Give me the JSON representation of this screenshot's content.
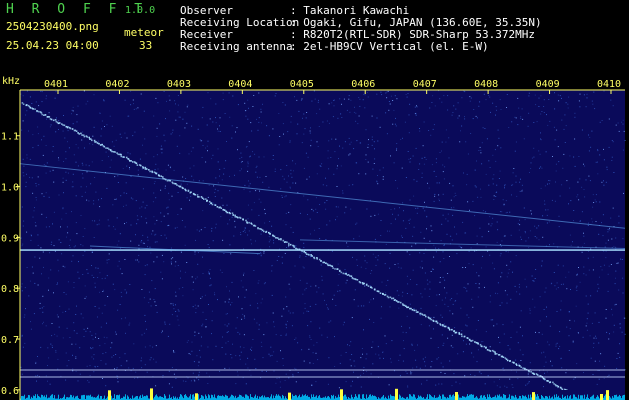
{
  "header": {
    "brand": "H R O F F T",
    "version": "1.0.0",
    "filename": "2504230400.png",
    "mode": "meteor",
    "datetime": "25.04.23 04:00",
    "count": "33",
    "info": [
      {
        "label": "Observer",
        "value": ": Takanori Kawachi"
      },
      {
        "label": "Receiving Location",
        "value": ": Ogaki, Gifu, JAPAN (136.60E, 35.35N)"
      },
      {
        "label": "Receiver",
        "value": ": R820T2(RTL-SDR) SDR-Sharp 53.372MHz"
      },
      {
        "label": "Receiving antenna",
        "value": ": 2el-HB9CV Vertical (el. E-W)"
      }
    ]
  },
  "chart_data": {
    "type": "heatmap",
    "ylabel": "kHz",
    "x_ticks": [
      "0401",
      "0402",
      "0403",
      "0404",
      "0405",
      "0406",
      "0407",
      "0408",
      "0409",
      "0410"
    ],
    "y_ticks": [
      "1.1",
      "1.0",
      "0.9",
      "0.8",
      "0.7",
      "0.6"
    ],
    "ylim": [
      0.58,
      1.19
    ],
    "colors": {
      "background": "#0a0a5a",
      "noise": "#3a6ad8",
      "signal": "#6ab8ff",
      "carrier": "#a8e0ff",
      "baseline": "#00c8ff",
      "burst": "#ffff40"
    }
  }
}
